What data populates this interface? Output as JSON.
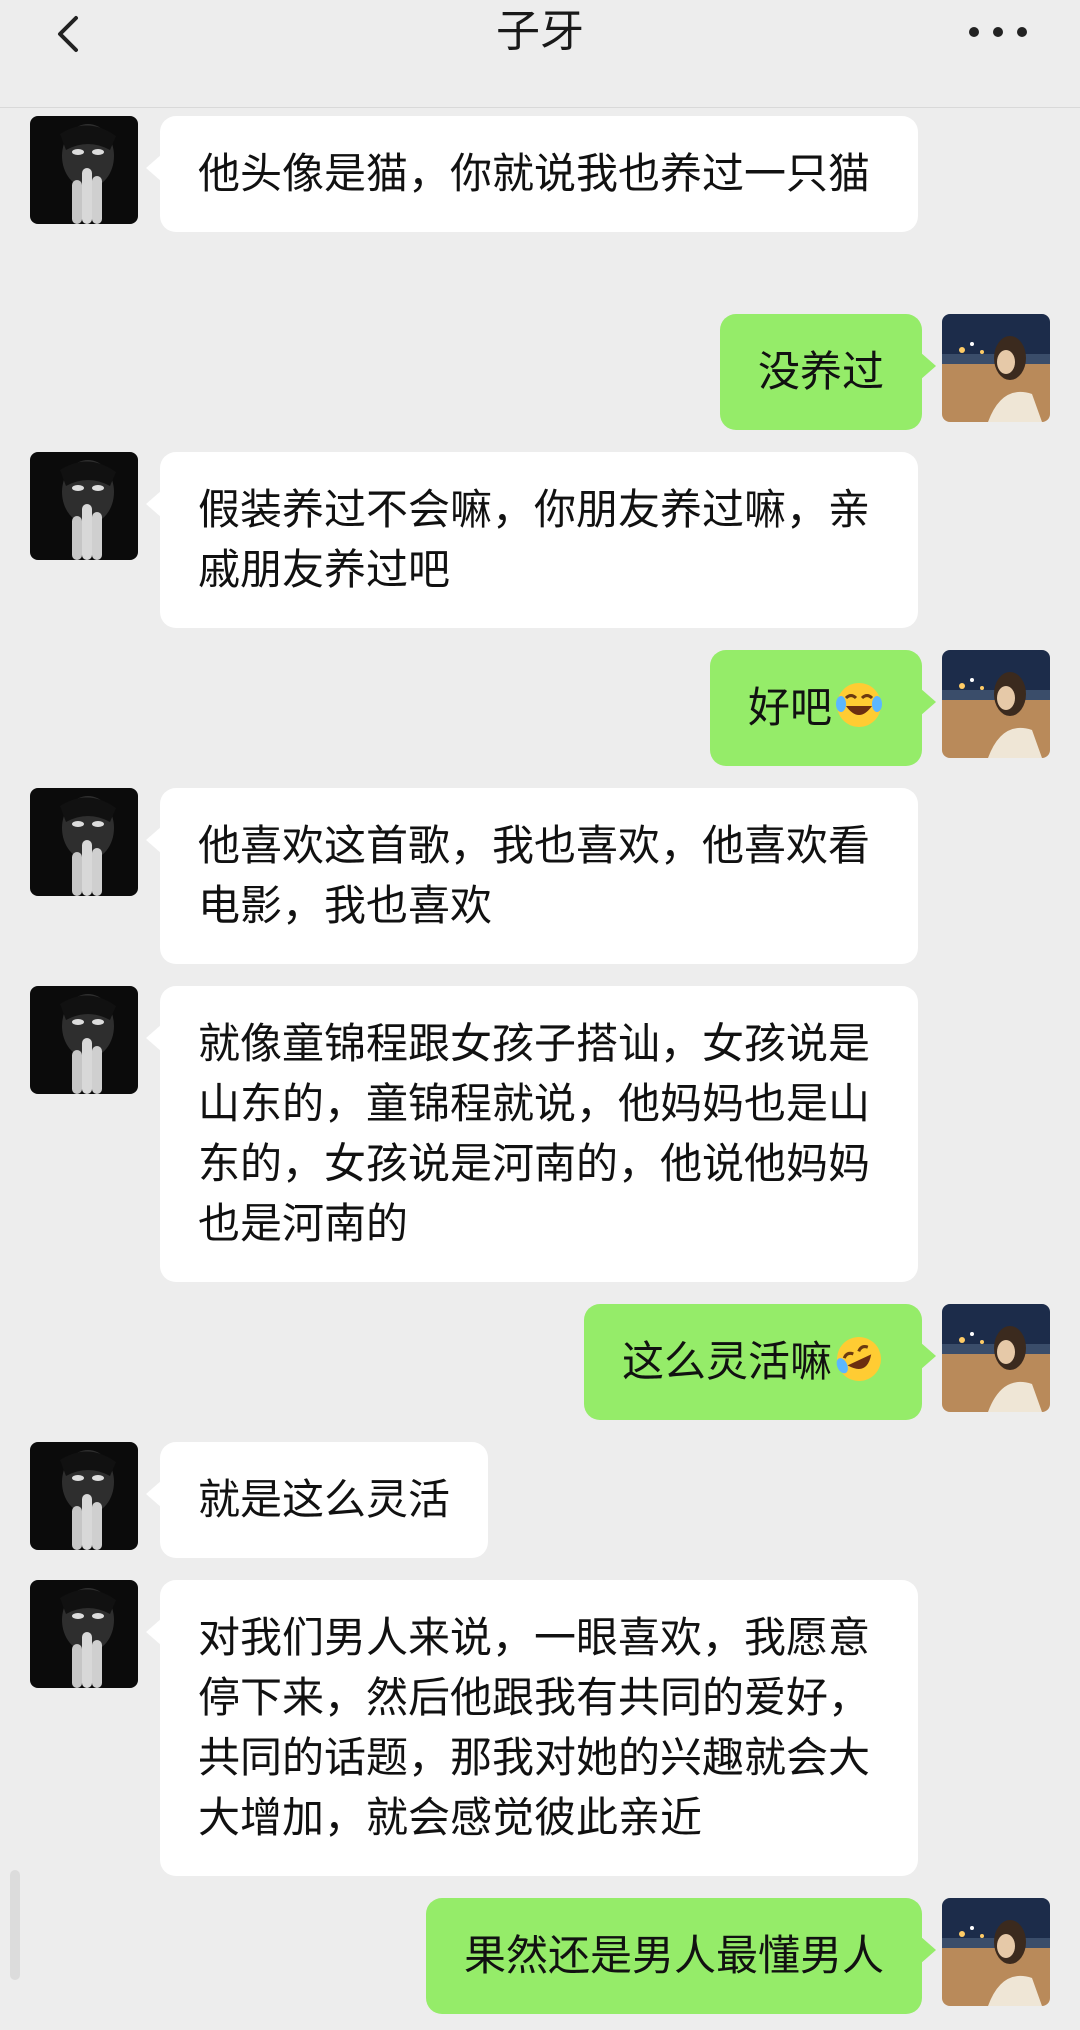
{
  "header": {
    "title": "子牙"
  },
  "messages": [
    {
      "side": "in",
      "text": "他头像是猫，你就说我也养过一只猫"
    },
    {
      "side": "out",
      "text": "没养过"
    },
    {
      "side": "in",
      "text": "假装养过不会嘛，你朋友养过嘛，亲戚朋友养过吧"
    },
    {
      "side": "out",
      "text": "好吧",
      "emoji": "laughing-tears-emoji"
    },
    {
      "side": "in",
      "text": "他喜欢这首歌，我也喜欢，他喜欢看电影，我也喜欢"
    },
    {
      "side": "in",
      "text": "就像童锦程跟女孩子搭讪，女孩说是山东的，童锦程就说，他妈妈也是山东的，女孩说是河南的，他说他妈妈也是河南的"
    },
    {
      "side": "out",
      "text": "这么灵活嘛",
      "emoji": "rolling-laughing-emoji"
    },
    {
      "side": "in",
      "text": "就是这么灵活"
    },
    {
      "side": "in",
      "text": "对我们男人来说，一眼喜欢，我愿意停下来，然后他跟我有共同的爱好，共同的话题，那我对她的兴趣就会大大增加，就会感觉彼此亲近"
    },
    {
      "side": "out",
      "text": "果然还是男人最懂男人"
    }
  ],
  "colors": {
    "background": "#ededed",
    "incoming_bubble": "#ffffff",
    "outgoing_bubble": "#95ec69"
  },
  "icons": {
    "back": "chevron-left-icon",
    "more": "more-dots-icon"
  }
}
